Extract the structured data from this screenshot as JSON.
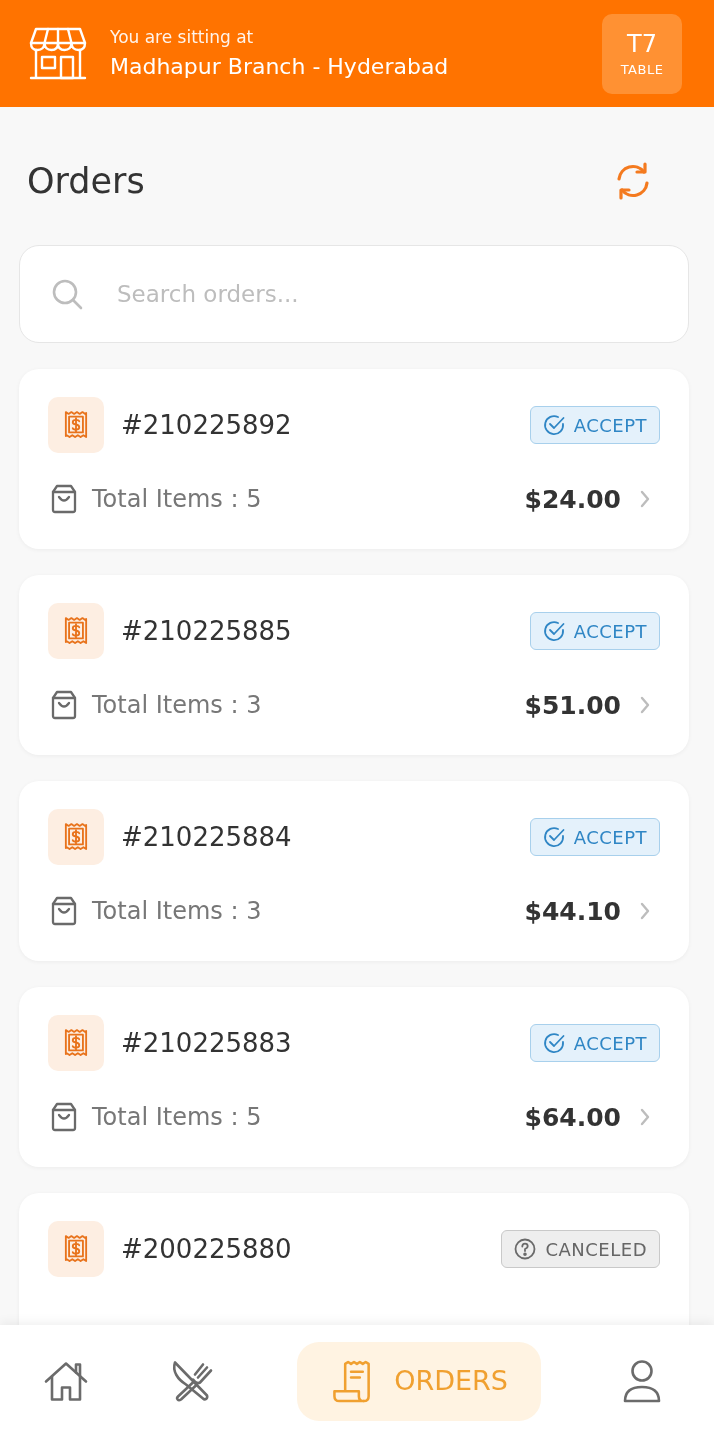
{
  "header": {
    "caption": "You are sitting at",
    "branch": "Madhapur Branch - Hyderabad",
    "table": {
      "code": "T7",
      "label": "TABLE"
    }
  },
  "page": {
    "title": "Orders"
  },
  "search": {
    "placeholder": "Search orders..."
  },
  "orders": [
    {
      "number": "#210225892",
      "status": {
        "kind": "accept",
        "label": "ACCEPT"
      },
      "items": "Total Items : 5",
      "total": "$24.00"
    },
    {
      "number": "#210225885",
      "status": {
        "kind": "accept",
        "label": "ACCEPT"
      },
      "items": "Total Items : 3",
      "total": "$51.00"
    },
    {
      "number": "#210225884",
      "status": {
        "kind": "accept",
        "label": "ACCEPT"
      },
      "items": "Total Items : 3",
      "total": "$44.10"
    },
    {
      "number": "#210225883",
      "status": {
        "kind": "accept",
        "label": "ACCEPT"
      },
      "items": "Total Items : 5",
      "total": "$64.00"
    },
    {
      "number": "#200225880",
      "status": {
        "kind": "canceled",
        "label": "CANCELED"
      }
    }
  ],
  "nav": [
    {
      "kind": "home",
      "selected": false
    },
    {
      "kind": "menu",
      "selected": false
    },
    {
      "kind": "orders",
      "label": "ORDERS",
      "selected": true
    },
    {
      "kind": "profile",
      "selected": false
    }
  ]
}
